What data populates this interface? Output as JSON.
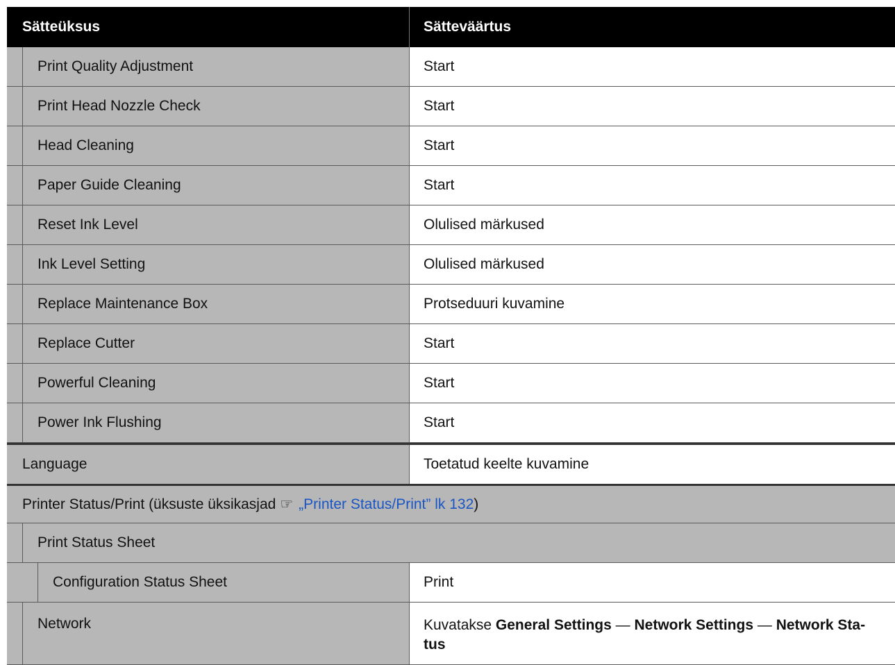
{
  "header": {
    "col1": "Sätteüksus",
    "col2": "Sätteväärtus"
  },
  "maintenance_rows": [
    {
      "label": "Print Quality Adjustment",
      "value": "Start"
    },
    {
      "label": "Print Head Nozzle Check",
      "value": "Start"
    },
    {
      "label": "Head Cleaning",
      "value": "Start"
    },
    {
      "label": "Paper Guide Cleaning",
      "value": "Start"
    },
    {
      "label": "Reset Ink Level",
      "value": "Olulised märkused"
    },
    {
      "label": "Ink Level Setting",
      "value": "Olulised märkused"
    },
    {
      "label": "Replace Maintenance Box",
      "value": "Protseduuri kuvamine"
    },
    {
      "label": "Replace Cutter",
      "value": "Start"
    },
    {
      "label": "Powerful Cleaning",
      "value": "Start"
    },
    {
      "label": "Power Ink Flushing",
      "value": "Start"
    }
  ],
  "language": {
    "label": "Language",
    "value": "Toetatud keelte kuvamine"
  },
  "printer_status": {
    "prefix": "Printer Status/Print (üksuste üksikasjad",
    "link_text": "„Printer Status/Print” lk 132",
    "suffix": ")",
    "print_status_sheet": "Print Status Sheet",
    "config_label": "Configuration Status Sheet",
    "config_value": "Print",
    "network_label": "Network",
    "network_value": {
      "intro": "Kuvatakse",
      "part1": "General Settings",
      "sep": "—",
      "part2": "Network Settings",
      "part3a": "Network Sta-",
      "part3b": "tus"
    }
  },
  "icons": {
    "pointer": "hand-pointer-icon"
  }
}
